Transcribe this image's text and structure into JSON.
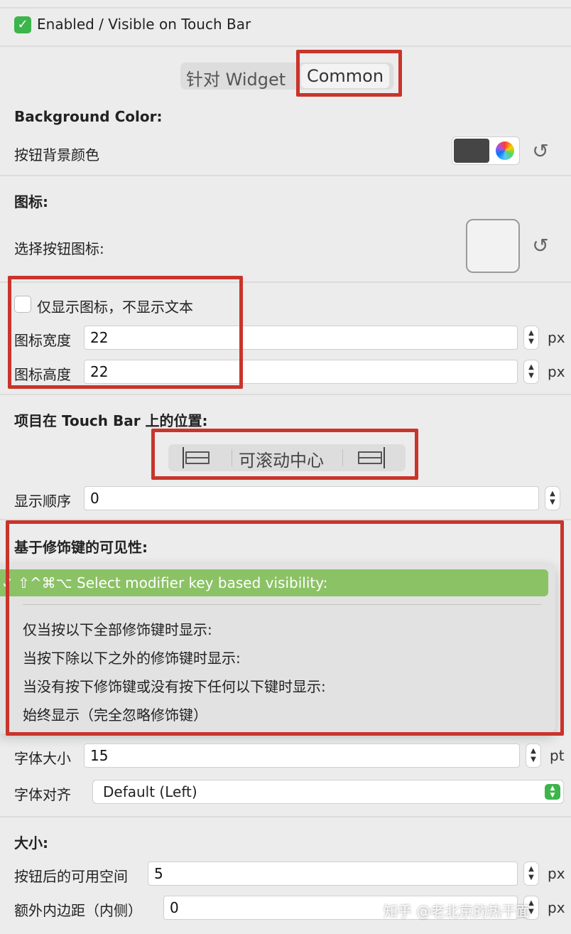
{
  "enabled": {
    "label": "Enabled / Visible on Touch Bar",
    "checked": true
  },
  "segment_top": {
    "widget": "针对 Widget",
    "common": "Common",
    "selected": "Common"
  },
  "background": {
    "title": "Background Color:",
    "label": "按钮背景颜色",
    "swatch_color": "#454545"
  },
  "icon": {
    "title": "图标:",
    "select_label": "选择按钮图标:"
  },
  "icon_only": {
    "label": "仅显示图标，不显示文本",
    "checked": false
  },
  "icon_width": {
    "label": "图标宽度",
    "value": "22",
    "unit": "px"
  },
  "icon_height": {
    "label": "图标高度",
    "value": "22",
    "unit": "px"
  },
  "position": {
    "title": "项目在 Touch Bar 上的位置:",
    "center_label": "可滚动中心"
  },
  "order": {
    "label": "显示顺序",
    "value": "0"
  },
  "modifier": {
    "title": "基于修饰键的可见性:",
    "selected_prefix": "✓ ⇧^⌘⌥",
    "selected_label": "Select modifier key based visibility:",
    "options": [
      "仅当按以下全部修饰键时显示:",
      "当按下除以下之外的修饰键时显示:",
      "当没有按下修饰键或没有按下任何以下键时显示:",
      "始终显示（完全忽略修饰键）"
    ]
  },
  "font_size": {
    "label": "字体大小",
    "value": "15",
    "unit": "pt"
  },
  "font_align": {
    "label": "字体对齐",
    "value": "Default (Left)"
  },
  "size": {
    "title": "大小:",
    "space_label": "按钮后的可用空间",
    "space_value": "5",
    "space_unit": "px",
    "padding_label": "额外内边距（内侧）",
    "padding_value": "0",
    "padding_unit": "px"
  },
  "watermark": "知乎 @老北京的热干面",
  "colors": {
    "accent_green": "#8bc265",
    "check_green": "#3cb54a",
    "highlight_red": "#c9342b"
  }
}
